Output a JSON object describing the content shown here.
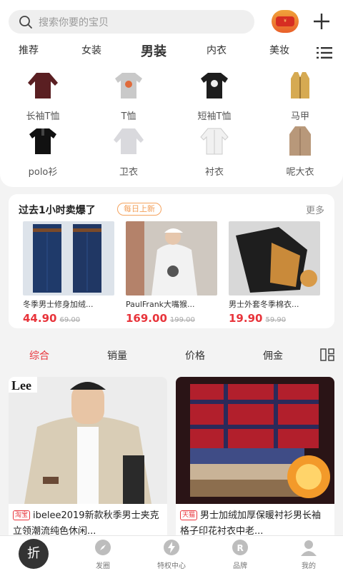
{
  "search": {
    "placeholder": "搜索你要的宝贝"
  },
  "colors": {
    "accent": "#e8343b",
    "badge": "#f39f5a"
  },
  "category_tabs": [
    "推荐",
    "女装",
    "男装",
    "内衣",
    "美妆"
  ],
  "active_category": "男装",
  "subcategories": [
    {
      "label": "长袖T恤",
      "icon": "longsleeve-shirt"
    },
    {
      "label": "T恤",
      "icon": "tshirt"
    },
    {
      "label": "短袖T恤",
      "icon": "shortsleeve-shirt"
    },
    {
      "label": "马甲",
      "icon": "vest"
    },
    {
      "label": "polo衫",
      "icon": "polo"
    },
    {
      "label": "卫衣",
      "icon": "sweatshirt"
    },
    {
      "label": "衬衣",
      "icon": "dress-shirt"
    },
    {
      "label": "呢大衣",
      "icon": "wool-coat"
    }
  ],
  "hot": {
    "title": "过去1小时卖爆了",
    "badge": "每日上新",
    "more": "更多",
    "items": [
      {
        "name": "冬季男士修身加绒...",
        "price": "44.90",
        "old_price": "69.00"
      },
      {
        "name": "PaulFrank大嘴猴...",
        "price": "169.00",
        "old_price": "199.00"
      },
      {
        "name": "男士外套冬季棉衣...",
        "price": "19.90",
        "old_price": "59.90"
      }
    ]
  },
  "sort_tabs": [
    "综合",
    "销量",
    "价格",
    "佣金"
  ],
  "active_sort": "综合",
  "products": [
    {
      "shop": "淘宝",
      "title": "ibelee2019新款秋季男士夹克立领潮流纯色休闲...",
      "logo": "Lee"
    },
    {
      "shop": "天猫",
      "title": "男士加绒加厚保暖衬衫男长袖格子印花衬衣中老..."
    }
  ],
  "tabbar": {
    "main": "折",
    "items": [
      "发圈",
      "特权中心",
      "品牌",
      "我的"
    ]
  }
}
